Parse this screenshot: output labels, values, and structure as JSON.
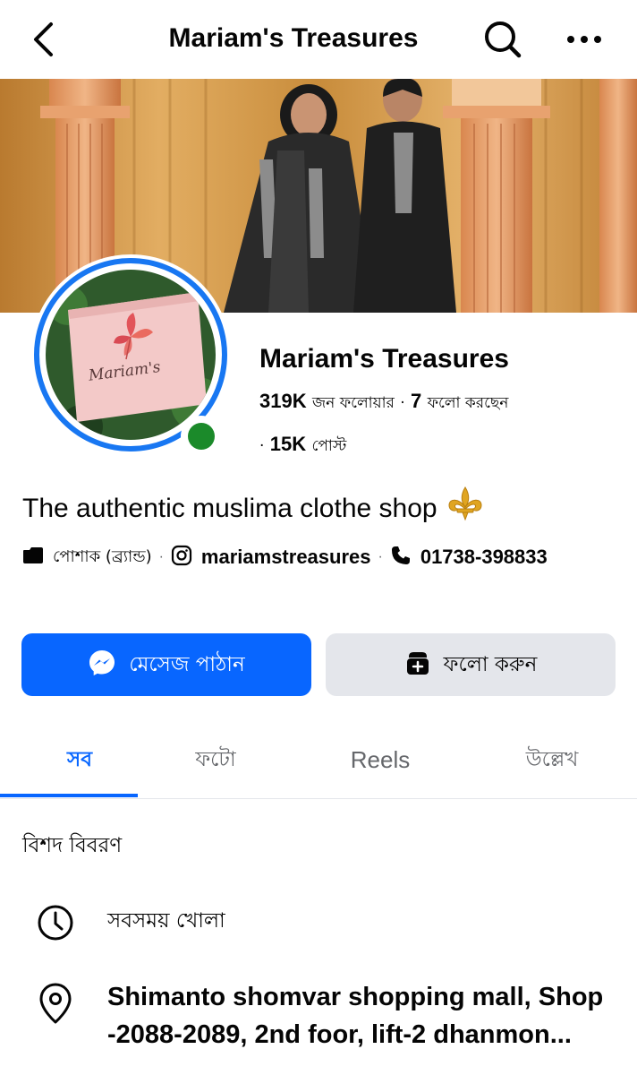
{
  "header": {
    "title": "Mariam's Treasures"
  },
  "profile": {
    "name": "Mariam's Treasures",
    "followers_count": "319K",
    "followers_label": "জন ফলোয়ার",
    "following_separator": "·",
    "following_count": "7",
    "following_label": "ফলো করছেন",
    "posts_separator": "·",
    "posts_count": "15K",
    "posts_label": "পোস্ট",
    "avatar_text": "Mariam's",
    "online": true
  },
  "bio": {
    "text": "The authentic muslima clothe shop",
    "emoji": "⚜️"
  },
  "info": {
    "category": "পোশাক (ব্র্যান্ড)",
    "instagram": "mariamstreasures",
    "phone": "01738-398833",
    "separator": "·"
  },
  "actions": {
    "message_label": "মেসেজ পাঠান",
    "follow_label": "ফলো করুন"
  },
  "tabs": [
    {
      "label": "সব",
      "active": true
    },
    {
      "label": "ফটো",
      "active": false
    },
    {
      "label": "Reels",
      "active": false
    },
    {
      "label": "উল্লেখ",
      "active": false
    }
  ],
  "details": {
    "heading": "বিশদ বিবরণ",
    "hours": "সবসময় খোলা",
    "address": "Shimanto shomvar shopping mall, Shop -2088-2089, 2nd foor, lift-2 dhanmon..."
  },
  "colors": {
    "accent": "#0866ff",
    "online": "#1b8a2a",
    "secondary_button": "#e4e6eb"
  }
}
